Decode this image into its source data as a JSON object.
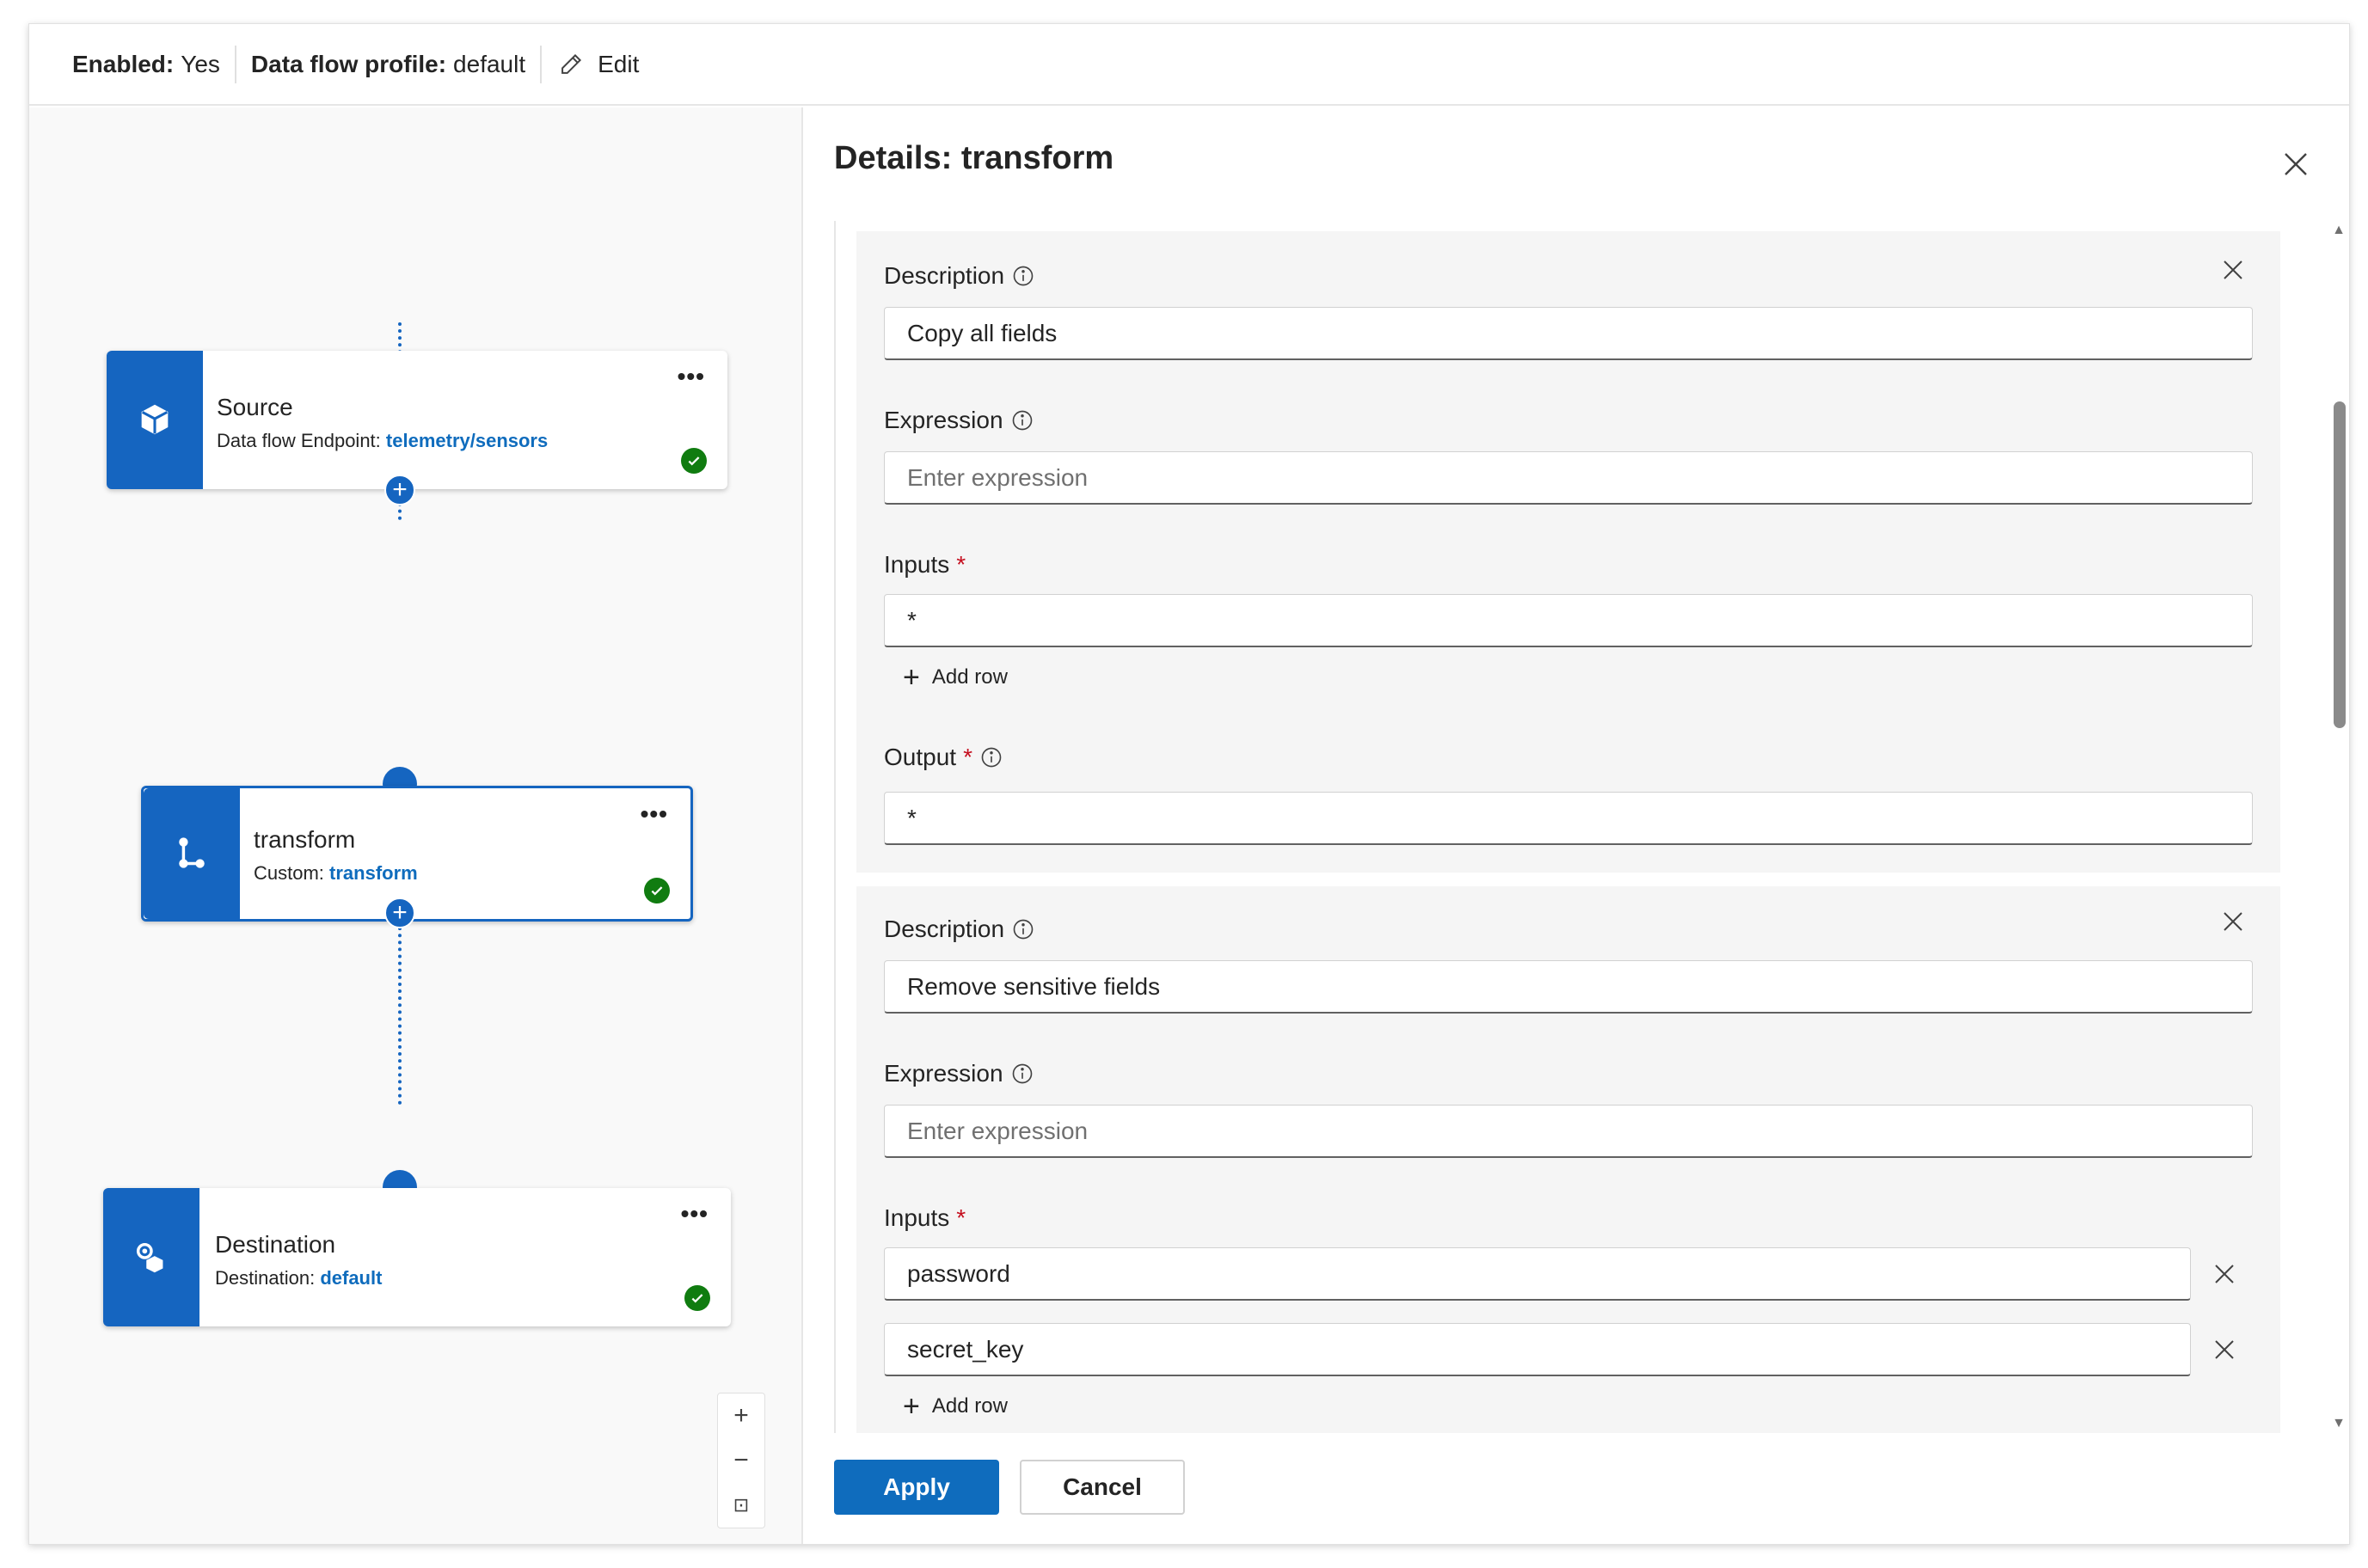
{
  "topbar": {
    "enabled_label": "Enabled:",
    "enabled_value": "Yes",
    "profile_label": "Data flow profile:",
    "profile_value": "default",
    "edit_label": "Edit"
  },
  "canvas": {
    "source": {
      "title": "Source",
      "sub_label": "Data flow Endpoint:",
      "sub_link": "telemetry/sensors",
      "icon": "cube-icon"
    },
    "transform": {
      "title": "transform",
      "sub_label": "Custom:",
      "sub_link": "transform",
      "icon": "branch-icon"
    },
    "destination": {
      "title": "Destination",
      "sub_label": "Destination:",
      "sub_link": "default",
      "icon": "destination-icon"
    },
    "more_label": "•••",
    "add_label": "+",
    "zoom": {
      "in": "+",
      "out": "−",
      "fit": "⊡"
    }
  },
  "panel": {
    "title": "Details: transform",
    "cards": [
      {
        "description_label": "Description",
        "description_value": "Copy all fields",
        "expression_label": "Expression",
        "expression_placeholder": "Enter expression",
        "inputs_label": "Inputs",
        "inputs": [
          "*"
        ],
        "add_row": "Add row",
        "output_label": "Output",
        "output_value": "*"
      },
      {
        "description_label": "Description",
        "description_value": "Remove sensitive fields",
        "expression_label": "Expression",
        "expression_placeholder": "Enter expression",
        "inputs_label": "Inputs",
        "inputs": [
          "password",
          "secret_key"
        ],
        "add_row": "Add row"
      }
    ],
    "required_mark": "*",
    "apply_label": "Apply",
    "cancel_label": "Cancel"
  },
  "colors": {
    "accent": "#1565c0",
    "primary_button": "#0f6cbd",
    "success": "#107c10",
    "required": "#c50f1f"
  }
}
